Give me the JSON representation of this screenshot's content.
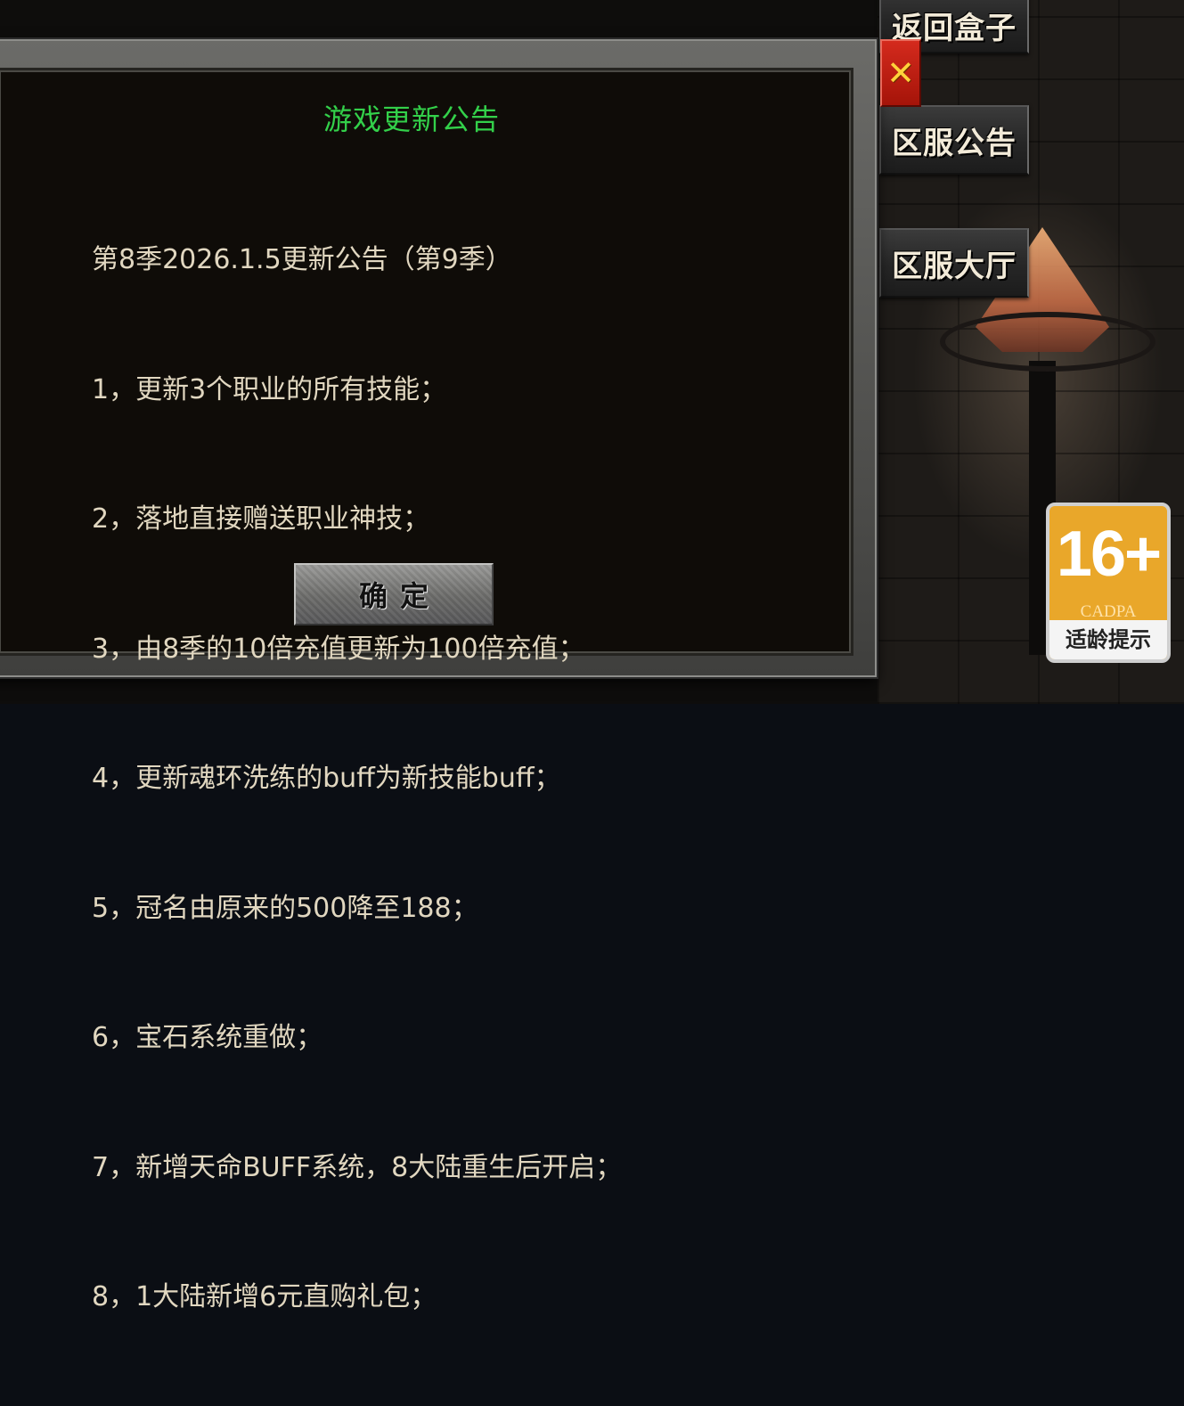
{
  "side_menu": {
    "back_label": "返回盒子",
    "notice_label": "区服公告",
    "hall_label": "区服大厅"
  },
  "dialog": {
    "title": "游戏更新公告",
    "lines": [
      "第8季2026.1.5更新公告（第9季）",
      "1，更新3个职业的所有技能；",
      "2，落地直接赠送职业神技；",
      "3，由8季的10倍充值更新为100倍充值；",
      "4，更新魂环洗练的buff为新技能buff；",
      "5，冠名由原来的500降至188；",
      "6，宝石系统重做；",
      "7，新增天命BUFF系统，8大陆重生后开启；",
      "8，1大陆新增6元直购礼包；"
    ],
    "confirm_label": "确定",
    "close_icon": "close-icon"
  },
  "age_rating": {
    "age": "16+",
    "org": "CADPA",
    "tip": "适龄提示",
    "color": "#e9a72a"
  },
  "colors": {
    "title_green": "#33d04a",
    "body_text": "#e1d7c0",
    "close_red": "#c41d10"
  }
}
